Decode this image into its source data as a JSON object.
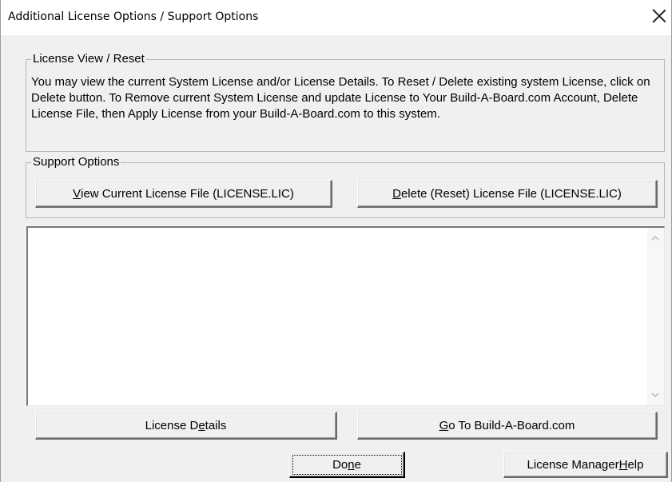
{
  "window": {
    "title": "Additional License Options / Support Options"
  },
  "license_group": {
    "legend": "License View / Reset",
    "description": "You may view the current System License and/or License Details.  To Reset / Delete existing system License, click on Delete button.  To Remove current System License and update License to Your Build-A-Board.com Account, Delete License File, then Apply License from your Build-A-Board.com to this system."
  },
  "support_group": {
    "legend": "Support Options",
    "view_button": {
      "mnemonic": "V",
      "rest": "iew Current License File (LICENSE.LIC)"
    },
    "delete_button": {
      "mnemonic": "D",
      "rest": "elete (Reset) License File (LICENSE.LIC)"
    }
  },
  "output_area": {
    "value": ""
  },
  "buttons": {
    "license_details": {
      "pre": "License D",
      "mnemonic": "e",
      "post": "tails"
    },
    "goto_site": {
      "mnemonic": "G",
      "post": "o To Build-A-Board.com"
    },
    "done": {
      "pre": "Do",
      "mnemonic": "n",
      "post": "e"
    },
    "help": {
      "pre": "License Manager ",
      "mnemonic": "H",
      "post": "elp"
    }
  },
  "icons": {
    "close": "close-icon",
    "scroll_up": "chevron-up-icon",
    "scroll_down": "chevron-down-icon"
  }
}
